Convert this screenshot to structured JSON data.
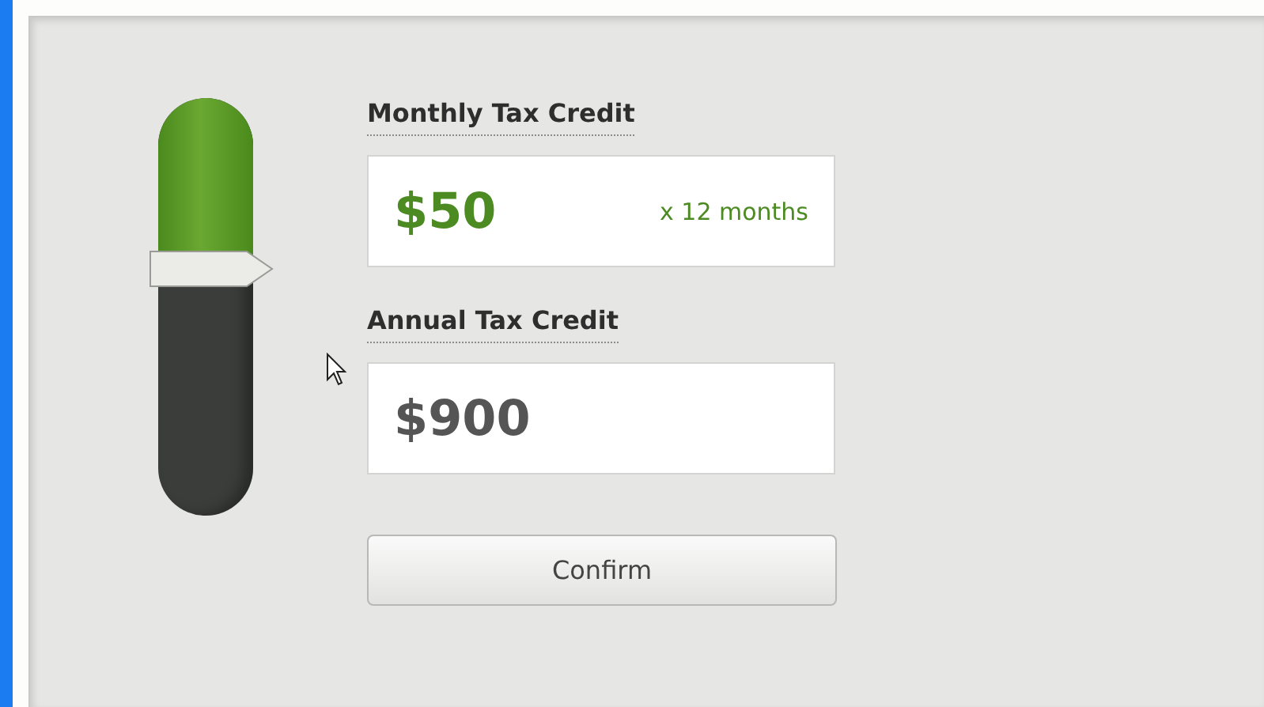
{
  "slider": {
    "level": 0.59
  },
  "fields": [
    {
      "label": "Monthly Tax Credit",
      "value": "$50",
      "suffix": "x 12 months",
      "highlighted": true
    },
    {
      "label": "Annual Tax Credit",
      "value": "$900",
      "highlighted": false
    }
  ],
  "button": {
    "label": "Confirm"
  }
}
